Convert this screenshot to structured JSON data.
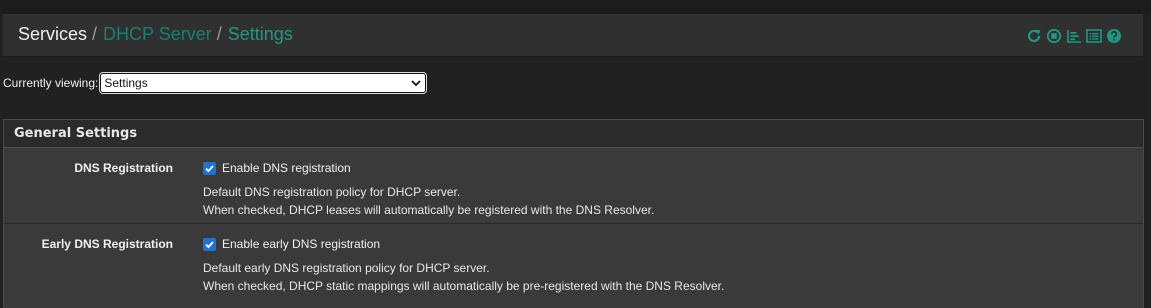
{
  "breadcrumb": {
    "root": "Services",
    "sep1": "/",
    "parent": "DHCP Server",
    "sep2": "/",
    "current": "Settings"
  },
  "header_icons": [
    "reload-icon",
    "stop-icon",
    "chart-icon",
    "log-list-icon",
    "help-icon"
  ],
  "viewing": {
    "label": "Currently viewing:",
    "selected": "Settings"
  },
  "panel": {
    "title": "General Settings",
    "rows": [
      {
        "label": "DNS Registration",
        "checkbox_label": "Enable DNS registration",
        "checked": true,
        "help_line1": "Default DNS registration policy for DHCP server.",
        "help_line2": "When checked, DHCP leases will automatically be registered with the DNS Resolver."
      },
      {
        "label": "Early DNS Registration",
        "checkbox_label": "Enable early DNS registration",
        "checked": true,
        "help_line1": "Default early DNS registration policy for DHCP server.",
        "help_line2": "When checked, DHCP static mappings will automatically be pre-registered with the DNS Resolver."
      }
    ]
  },
  "colors": {
    "accent": "#1a9a82",
    "checkbox": "#1a73d9",
    "background": "#212121"
  }
}
